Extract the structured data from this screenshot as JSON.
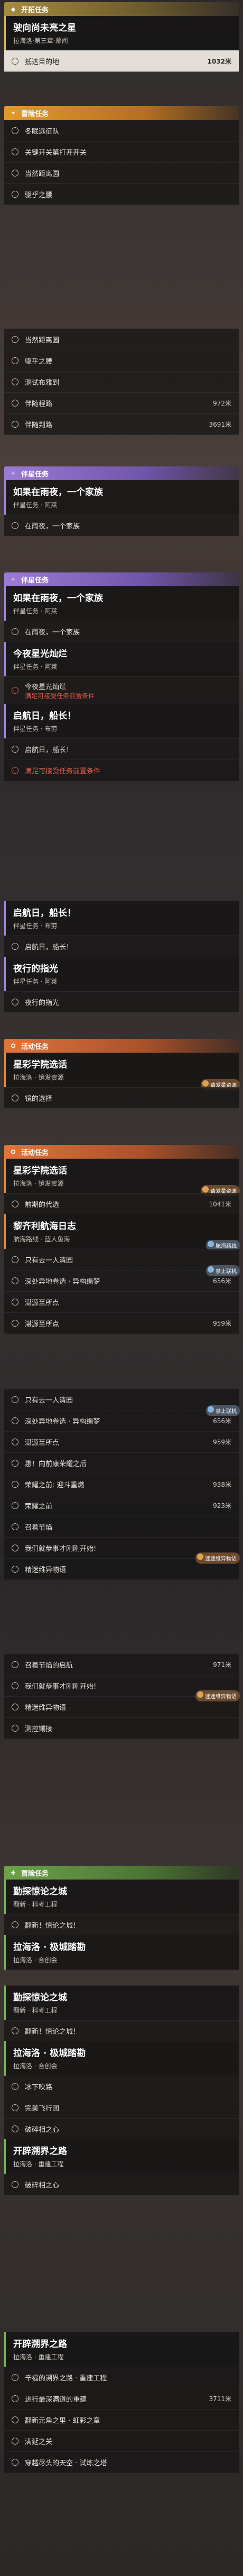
{
  "trailblaze": {
    "header": "开拓任务",
    "main_title": "驶向尚未亮之星",
    "main_sub": "拉海洛·第三章·幕间",
    "rows": [
      {
        "label": "抵达目的地",
        "dist": "1032米",
        "highlight": true
      }
    ]
  },
  "side1": {
    "header": "冒险任务",
    "rows": [
      {
        "label": "冬眠远征队",
        "dist": ""
      },
      {
        "label": "关键开关第打开开关",
        "dist": ""
      },
      {
        "label": "当然距离圆",
        "dist": ""
      },
      {
        "label": "驱乎之腰",
        "dist": ""
      }
    ]
  },
  "side2": {
    "rows": [
      {
        "label": "当然距离圆",
        "dist": ""
      },
      {
        "label": "驱乎之腰",
        "dist": ""
      },
      {
        "label": "测试布雅到",
        "dist": ""
      },
      {
        "label": "伴随程路",
        "dist": "972米"
      },
      {
        "label": "伴随到路",
        "dist": "3691米"
      }
    ]
  },
  "companion1": {
    "header": "伴星任务",
    "main_title": "如果在雨夜，一个家族",
    "main_sub": "伴星任务 · 阿莱",
    "rows": [
      {
        "label": "在雨夜，一个家族",
        "dist": ""
      }
    ]
  },
  "companion2": {
    "header": "伴星任务",
    "main_title": "如果在雨夜，一个家族",
    "main_sub": "伴星任务 · 阿莱",
    "rows": [
      {
        "label": "在雨夜，一个家族",
        "dist": ""
      }
    ],
    "card2_title": "今夜星光灿烂",
    "card2_sub": "伴星任务 · 阿莱",
    "warn_rows": [
      {
        "label": "今夜星光灿烂",
        "alert": "满足可接受任务前置条件"
      }
    ],
    "card3_title": "启航日，船长！",
    "card3_sub": "伴星任务 · 布劳",
    "rows3": [
      {
        "label": "启航日，船长！",
        "dist": ""
      }
    ],
    "warn3": {
      "label": "满足可接受任务前置条件",
      "alert": ""
    }
  },
  "companion3": {
    "card_title": "启航日，船长！",
    "card_sub": "伴星任务 · 布劳",
    "rows": [
      {
        "label": "启航日，船长！",
        "dist": ""
      }
    ],
    "card2_title": "夜行的指光",
    "card2_sub": "伴星任务 · 阿莱",
    "rows2": [
      {
        "label": "夜行的指光",
        "dist": ""
      }
    ]
  },
  "event1": {
    "header": "活动任务",
    "main_title": "星彩学院选话",
    "main_sub": "拉海洛 · 镜发资源",
    "badge": "请发星资源",
    "rows": [
      {
        "label": "镜的选择",
        "dist": ""
      }
    ]
  },
  "event2": {
    "header": "活动任务",
    "main_title": "星彩学院选话",
    "main_sub": "拉海洛 · 镜发资源",
    "badge": "请发星资源",
    "rows": [
      {
        "label": "前期的代选",
        "dist": "1041米"
      }
    ],
    "card2_title": "黎齐利航海日志",
    "card2_sub": "航海路线 · 蓝人鱼海",
    "badge2": "航海路线",
    "rows2": [
      {
        "label": "只有去一人清园",
        "dist": ""
      },
      {
        "label": "深处异地卷选 · 异构绳梦",
        "dist": "656米",
        "badge": "禁止联机"
      },
      {
        "label": "湛源至所点",
        "dist": ""
      },
      {
        "label": "湛源至所点",
        "dist": "959米"
      }
    ]
  },
  "event3": {
    "rows": [
      {
        "label": "只有去一人清园",
        "dist": ""
      },
      {
        "label": "深处异地卷选 · 异构绳梦",
        "dist": "656米",
        "badge": "禁止联机"
      },
      {
        "label": "湛源至所点",
        "dist": "959米"
      },
      {
        "label": "惠！向前康荣耀之后",
        "dist": ""
      },
      {
        "label": "荣耀之前: 迎斗重燃",
        "dist": "938米"
      },
      {
        "label": "荣耀之前",
        "dist": "923米"
      },
      {
        "label": "召着节焰",
        "dist": ""
      },
      {
        "label": "我们就恭事才刚刚开始!",
        "dist": ""
      },
      {
        "label": "精迷维异物语",
        "dist": "",
        "badge": "迷迷维异物语"
      }
    ]
  },
  "event4": {
    "rows": [
      {
        "label": "召着节焰的启航",
        "dist": "971米"
      },
      {
        "label": "我们就恭事才刚刚开始!",
        "dist": ""
      },
      {
        "label": "精迷维异物语",
        "dist": "",
        "badge": "迷迷维异物语"
      },
      {
        "label": "测控镶接",
        "dist": ""
      }
    ]
  },
  "adventure": {
    "header": "冒险任务",
    "cards": [
      {
        "title": "勤探惊论之城",
        "sub": "翻新 · 科考工程",
        "rows": [
          {
            "label": "翻新！惊论之城！",
            "dist": ""
          }
        ]
      },
      {
        "title": "拉海洛 · 极城踏勘",
        "sub": "拉海洛 · 合创会",
        "rows": []
      },
      {
        "title": "勤探惊论之城",
        "sub": "翻新 · 科考工程",
        "rows": [
          {
            "label": "翻新！惊论之城！",
            "dist": ""
          }
        ]
      },
      {
        "title": "拉海洛 · 极城踏勘",
        "sub": "拉海洛 · 合创会",
        "rows": [
          {
            "label": "冰下吹路",
            "dist": ""
          },
          {
            "label": "完美飞行团",
            "dist": ""
          },
          {
            "label": "破碎相之心",
            "dist": ""
          }
        ]
      },
      {
        "title": "开辟溯界之路",
        "sub": "拉海洛 · 重建工程",
        "rows": [
          {
            "label": "破碎相之心",
            "dist": ""
          }
        ]
      }
    ]
  },
  "adventure2": {
    "title": "开辟溯界之路",
    "sub": "拉海洛 · 重建工程",
    "rows": [
      {
        "label": "辛福的溯界之路 · 重建工程",
        "dist": ""
      },
      {
        "label": "进行最深满道的重建",
        "dist": "3711米"
      },
      {
        "label": "翻新元角之里 · 虹彩之章",
        "dist": ""
      },
      {
        "label": "满延之关",
        "dist": ""
      },
      {
        "label": "穿越尽头的天空 · 试炼之塔",
        "dist": ""
      }
    ]
  }
}
